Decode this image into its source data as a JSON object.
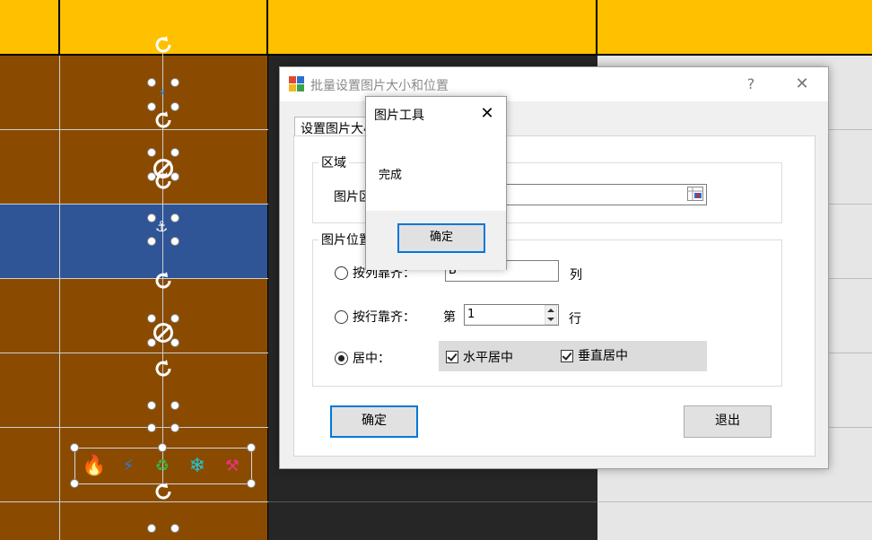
{
  "dialog": {
    "title": "批量设置图片大小和位置",
    "help_icon": "?",
    "close_icon": "✕",
    "tab_label": "设置图片大小和位置",
    "region_group": "区域",
    "picture_region_label": "图片区域：",
    "picture_region_value": "",
    "position_group": "图片位置",
    "align_column_label": "按列靠齐：",
    "align_column_value": "B",
    "column_suffix": "列",
    "align_row_label": "按行靠齐：",
    "row_prefix": "第",
    "align_row_value": "1",
    "row_suffix": "行",
    "center_label": "居中：",
    "horizontal_center_label": "水平居中",
    "vertical_center_label": "垂直居中",
    "ok_button": "确定",
    "exit_button": "退出"
  },
  "message_box": {
    "title": "图片工具",
    "close_icon": "✕",
    "message": "完成",
    "ok_button": "确定"
  },
  "shapes": {
    "icons": [
      "fire-icon",
      "lightning-icon",
      "recycle-icon",
      "snowflake-icon",
      "hammer-icon"
    ],
    "colors": {
      "fire": "#f4a020",
      "lightning": "#2a7de1",
      "recycle": "#3cb043",
      "snowflake": "#1fc7d4",
      "hammer": "#e8357a"
    }
  },
  "colors": {
    "header_yellow": "#ffc000",
    "cell_brown": "#8a4b00",
    "cell_blue": "#2f5597",
    "accent": "#0078d7"
  }
}
